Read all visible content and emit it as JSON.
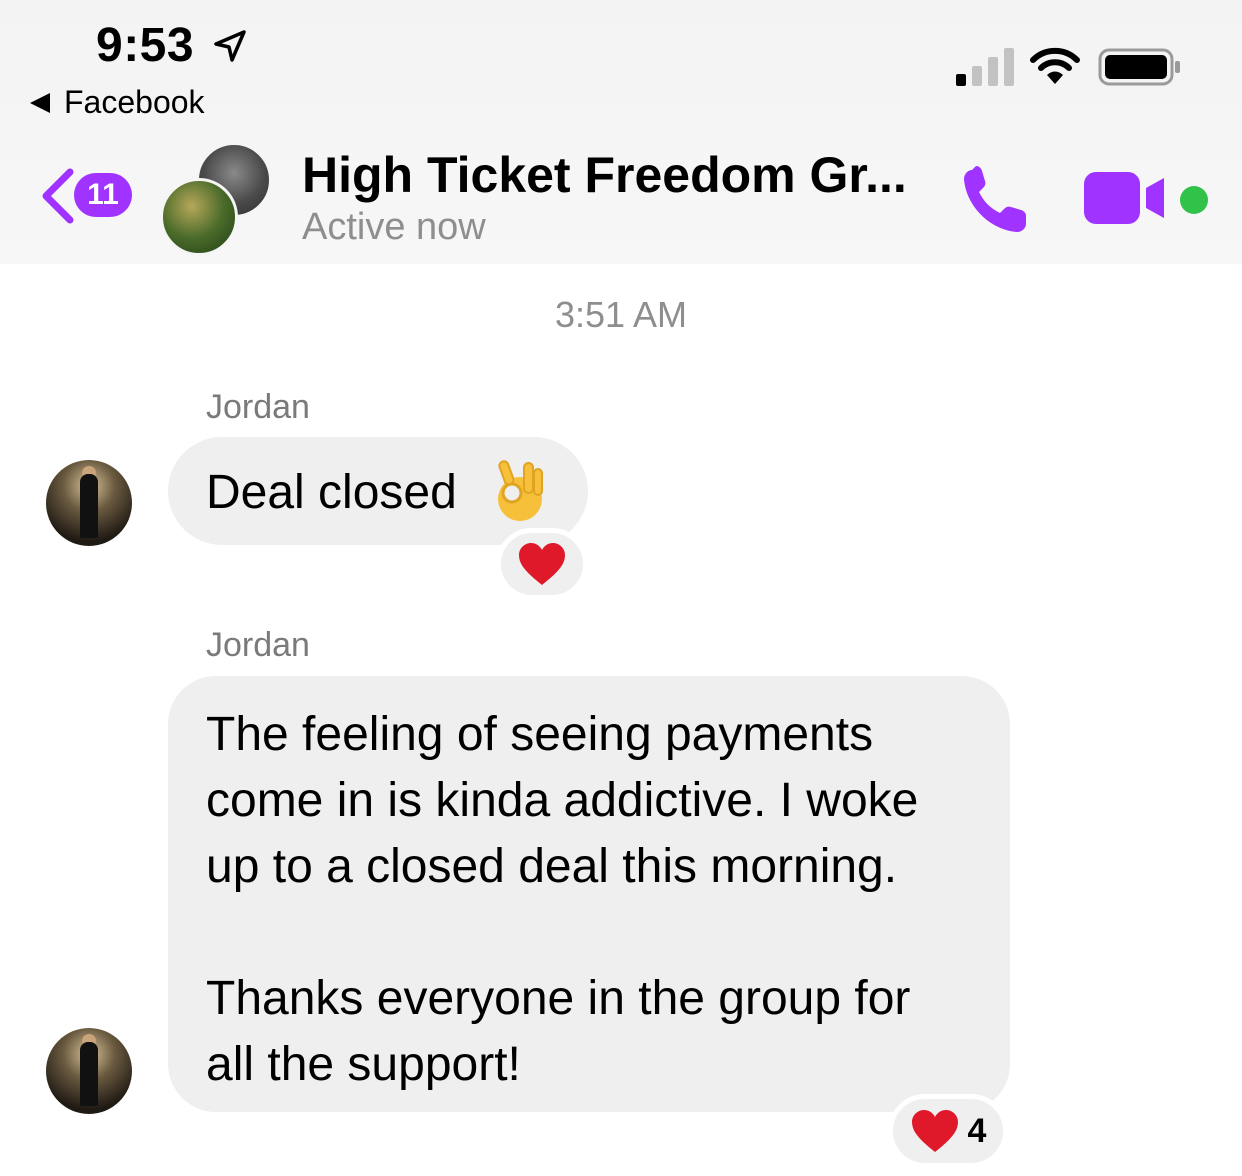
{
  "status_bar": {
    "time": "9:53",
    "back_app": "Facebook"
  },
  "header": {
    "unread_count": "11",
    "title": "High Ticket Freedom Gr...",
    "subtitle": "Active now"
  },
  "conversation": {
    "timestamp": "3:51 AM",
    "messages": [
      {
        "sender": "Jordan",
        "text": "Deal closed",
        "emoji": "ok-hand",
        "reaction_count": ""
      },
      {
        "sender": "Jordan",
        "text": "The feeling of seeing payments\ncome in is kinda addictive. I woke\nup to a closed deal this morning.\n\nThanks everyone in the group for\nall the support!",
        "reaction_count": "4"
      }
    ]
  },
  "colors": {
    "accent": "#a033ff",
    "online": "#31c24a",
    "bubble": "#efefef",
    "heart": "#e0192a"
  }
}
